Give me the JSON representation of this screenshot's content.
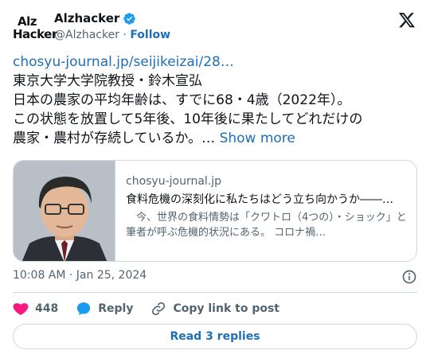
{
  "account": {
    "avatar_text_top": "Alz",
    "avatar_text_bottom": "Hacker",
    "name": "Alzhacker",
    "handle": "@Alzhacker",
    "separator": "·",
    "follow_label": "Follow",
    "verified": true
  },
  "tweet": {
    "link_text": "chosyu-journal.jp/seijikeizai/28…",
    "lines": [
      "東京大学大学院教授・鈴木宣弘",
      "日本の農家の平均年齢は、すでに68・4歳（2022年）。",
      "この状態を放置して5年後、10年後に果たしてどれだけの",
      "農家・農村が存続しているか。…"
    ],
    "show_more_label": "Show more"
  },
  "link_card": {
    "domain": "chosyu-journal.jp",
    "title": "食料危機の深刻化に私たちはどう立ち向かうか――…",
    "description": "　今、世界の食料情勢は「クワトロ（4つの）・ショック」と筆者が呼ぶ危機的状況にある。 コロナ禍…"
  },
  "meta": {
    "timestamp": "10:08 AM · Jan 25, 2024"
  },
  "actions": {
    "like_count": "448",
    "reply_label": "Reply",
    "copy_label": "Copy link to post"
  },
  "replies_button": {
    "label": "Read 3 replies"
  },
  "colors": {
    "link": "#1d6fb8",
    "verified": "#1d9bf0",
    "like": "#f91880",
    "reply": "#1d9bf0",
    "secondary_text": "#536471",
    "border": "#cfd9de"
  }
}
